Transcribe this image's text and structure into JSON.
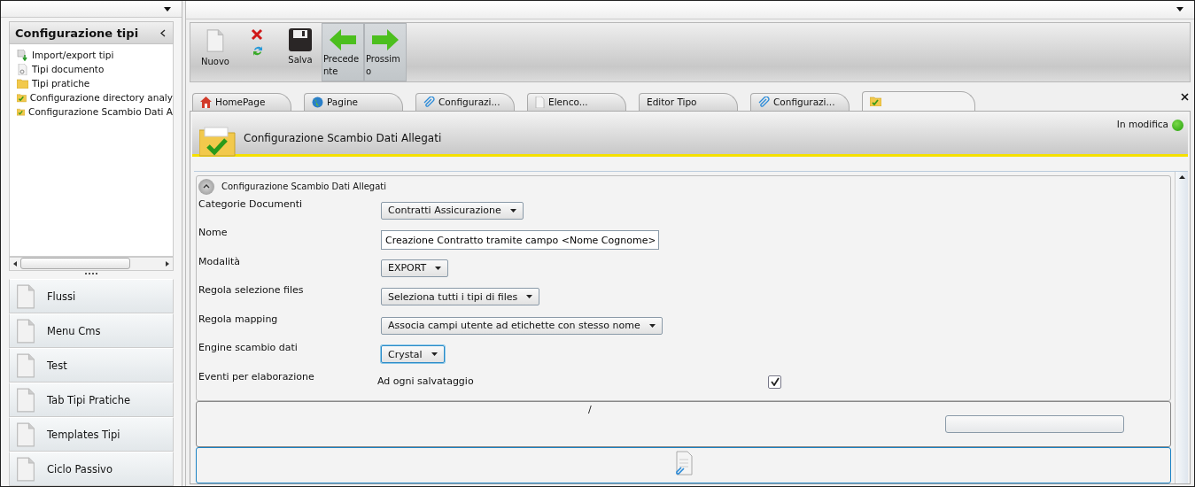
{
  "sidebar": {
    "title": "Configurazione tipi",
    "tree": [
      {
        "label": "Import/export tipi",
        "kind": "import"
      },
      {
        "label": "Tipi documento",
        "kind": "doc"
      },
      {
        "label": "Tipi pratiche",
        "kind": "folder"
      },
      {
        "label": "Configurazione directory analy",
        "kind": "folder-check"
      },
      {
        "label": "Configurazione Scambio Dati A",
        "kind": "folder-check"
      }
    ],
    "nav": [
      "Flussi",
      "Menu Cms",
      "Test",
      "Tab Tipi Pratiche",
      "Templates Tipi",
      "Ciclo Passivo"
    ]
  },
  "toolbar": [
    {
      "kind": "new",
      "label": "Nuovo",
      "selected": false
    },
    {
      "kind": "delete-refresh",
      "selected": false
    },
    {
      "kind": "save",
      "label": "Salva",
      "selected": false
    },
    {
      "kind": "back",
      "label": "Precedente",
      "selected": true
    },
    {
      "kind": "forward",
      "label": "Prossimo",
      "selected": true
    }
  ],
  "tabs": [
    {
      "label": "HomePage",
      "kind": "home",
      "selected": false
    },
    {
      "label": "Pagine",
      "kind": "globe",
      "selected": false
    },
    {
      "label": "Configurazi...",
      "kind": "clip",
      "selected": false
    },
    {
      "label": "Elenco...",
      "kind": "doc",
      "selected": false
    },
    {
      "label": "Editor Tipo",
      "kind": "plain",
      "selected": false
    },
    {
      "label": "Configurazi...",
      "kind": "clip",
      "selected": false
    },
    {
      "kind": "folder",
      "selected": true
    }
  ],
  "page": {
    "title": "Configurazione Scambio Dati Allegati",
    "status": "In modifica",
    "section": {
      "title": "Configurazione Scambio Dati Allegati",
      "expanded": true
    },
    "fields": [
      {
        "label": "Categorie Documenti",
        "kind": "select",
        "value": "Contratti Assicurazione"
      },
      {
        "label": "Nome",
        "kind": "text",
        "value": "Creazione Contratto tramite campo <Nome Cognome>"
      },
      {
        "label": "Modalità",
        "kind": "select",
        "value": "EXPORT"
      },
      {
        "label": "Regola selezione files",
        "kind": "select",
        "value": "Seleziona tutti i tipi di files"
      },
      {
        "label": "Regola mapping",
        "kind": "select",
        "value": "Associa campi utente ad etichette con stesso nome"
      },
      {
        "label": "Engine scambio dati",
        "kind": "select",
        "value": "Crystal",
        "focused": true
      },
      {
        "label": "Eventi per elaborazione",
        "kind": "checkbox",
        "option": "Ad ogni salvataggio",
        "checked": true
      }
    ],
    "path_text": "/"
  }
}
